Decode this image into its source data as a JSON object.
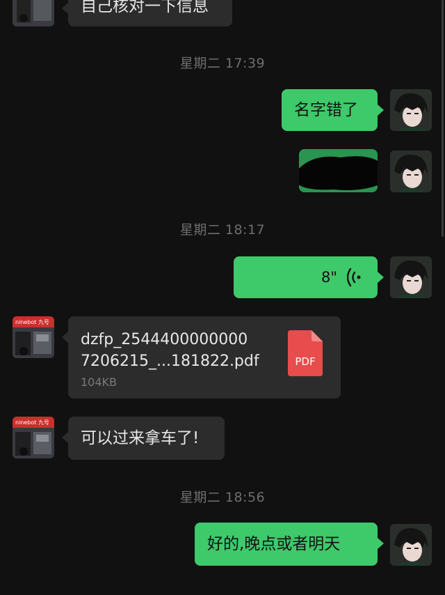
{
  "messages": {
    "top_partial_text": "自己核对一下信息",
    "ts1": "星期二 17:39",
    "m_name_wrong": "名字错了",
    "ts2": "星期二 18:17",
    "voice_duration": "8\"",
    "file": {
      "name_line1": "dzfp_2544400000000",
      "name_line2": "7206215_...181822.pdf",
      "size": "104KB",
      "badge": "PDF"
    },
    "m_pickup": "可以过来拿车了!",
    "ts3": "星期二 18:56",
    "m_reply": "好的,晚点或者明天"
  },
  "colors": {
    "background": "#111111",
    "outgoing_bubble": "#3ec96a",
    "incoming_bubble": "#2c2c2c",
    "pdf_red": "#e84c4c",
    "timestamp": "#6e6e6e"
  }
}
